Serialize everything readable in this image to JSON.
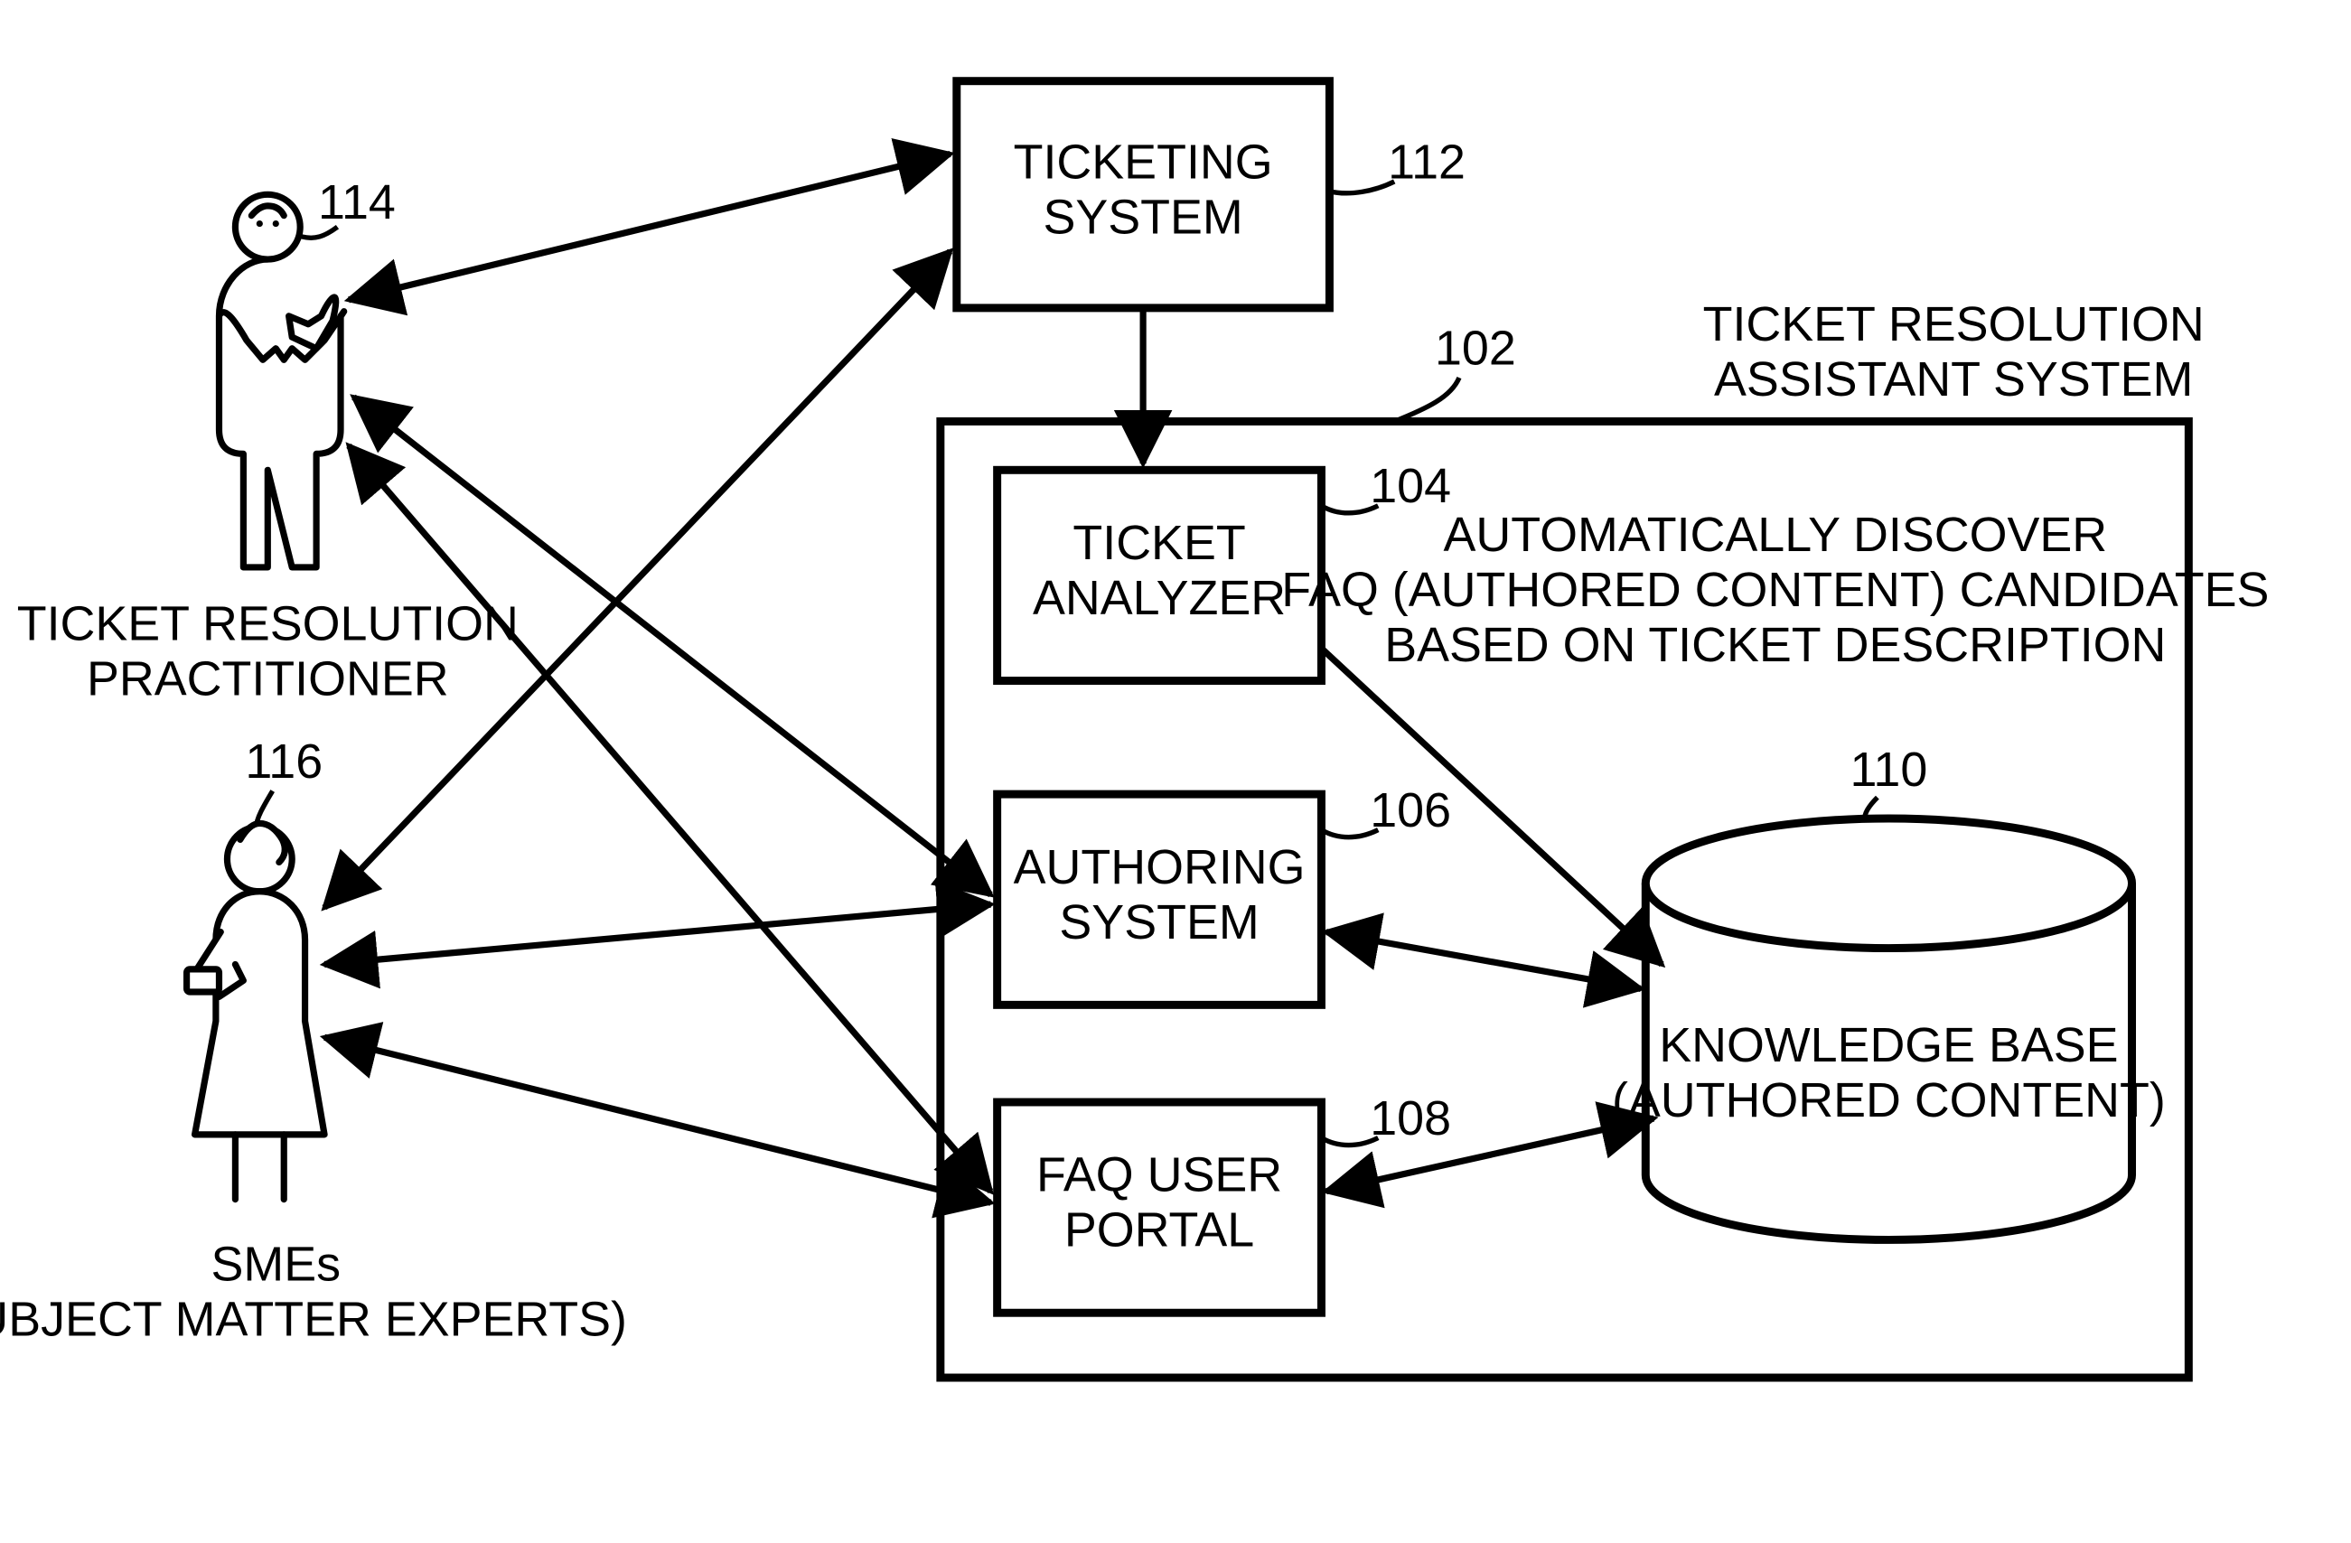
{
  "nodes": {
    "ticketing_system": {
      "label": [
        "TICKETING",
        "SYSTEM"
      ],
      "ref": "112"
    },
    "ticket_analyzer": {
      "label": [
        "TICKET",
        "ANALYZER"
      ],
      "ref": "104"
    },
    "authoring_system": {
      "label": [
        "AUTHORING",
        "SYSTEM"
      ],
      "ref": "106"
    },
    "faq_user_portal": {
      "label": [
        "FAQ USER",
        "PORTAL"
      ],
      "ref": "108"
    },
    "knowledge_base": {
      "label": [
        "KNOWLEDGE BASE",
        "(AUTHORED CONTENT)"
      ],
      "ref": "110"
    },
    "assistant_system": {
      "label": [
        "TICKET RESOLUTION",
        "ASSISTANT SYSTEM"
      ],
      "ref": "102"
    },
    "discover_note": {
      "label": [
        "AUTOMATICALLY DISCOVER",
        "FAQ (AUTHORED CONTENT) CANDIDATES",
        "BASED ON TICKET DESCRIPTION"
      ]
    },
    "practitioner": {
      "label": [
        "TICKET RESOLUTION",
        "PRACTITIONER"
      ],
      "ref": "114"
    },
    "smes": {
      "label": [
        "SMEs",
        "(SUBJECT MATTER EXPERTS)"
      ],
      "ref": "116"
    }
  },
  "edges": [
    {
      "from": "ticketing_system",
      "to": "ticket_analyzer",
      "dir": "one"
    },
    {
      "from": "ticket_analyzer",
      "to": "knowledge_base",
      "dir": "one"
    },
    {
      "from": "authoring_system",
      "to": "knowledge_base",
      "dir": "two"
    },
    {
      "from": "faq_user_portal",
      "to": "knowledge_base",
      "dir": "two"
    },
    {
      "from": "practitioner",
      "to": "ticketing_system",
      "dir": "two"
    },
    {
      "from": "practitioner",
      "to": "authoring_system",
      "dir": "two"
    },
    {
      "from": "practitioner",
      "to": "faq_user_portal",
      "dir": "two"
    },
    {
      "from": "smes",
      "to": "ticketing_system",
      "dir": "two"
    },
    {
      "from": "smes",
      "to": "authoring_system",
      "dir": "two"
    },
    {
      "from": "smes",
      "to": "faq_user_portal",
      "dir": "two"
    }
  ]
}
